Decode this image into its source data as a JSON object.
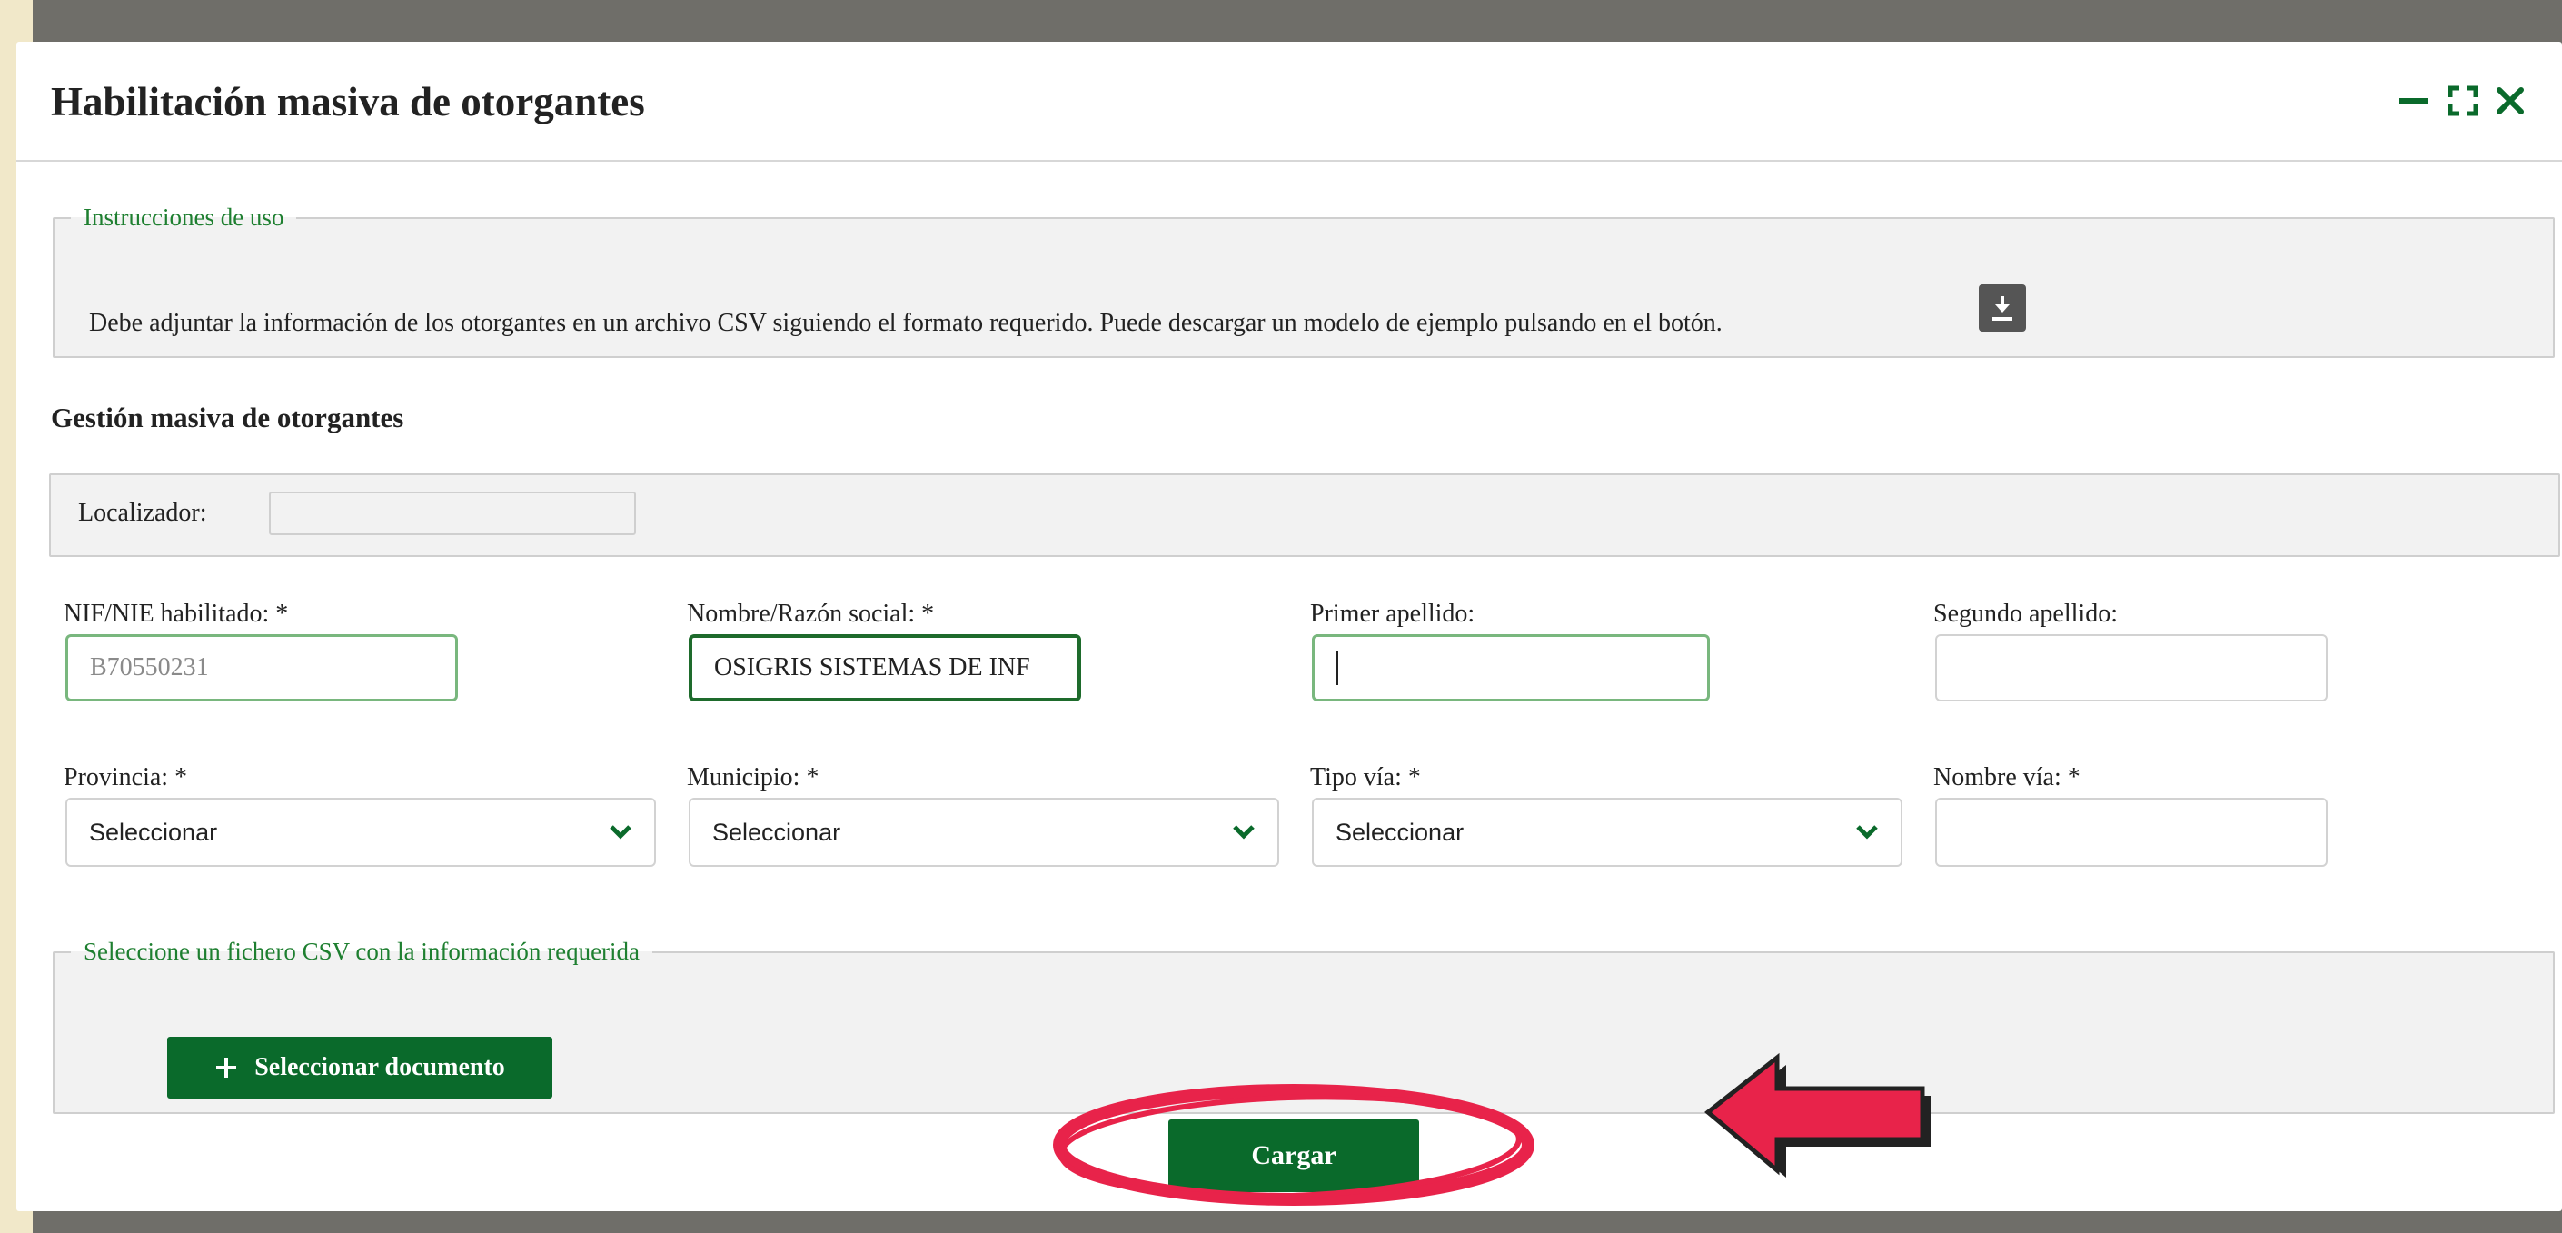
{
  "modal": {
    "title": "Habilitación masiva de otorgantes",
    "controls": [
      "minimize-icon",
      "maximize-icon",
      "close-icon"
    ]
  },
  "instructions": {
    "legend": "Instrucciones de uso",
    "text": "Debe adjuntar la información de los otorgantes en un archivo CSV siguiendo el formato requerido. Puede descargar un modelo de ejemplo pulsando en el botón.",
    "download_icon": "download-icon"
  },
  "section": {
    "title": "Gestión masiva de otorgantes"
  },
  "localizador": {
    "label": "Localizador:",
    "value": ""
  },
  "fields": {
    "nif": {
      "label": "NIF/NIE habilitado: *",
      "value": "B70550231"
    },
    "nombre": {
      "label": "Nombre/Razón social: *",
      "value": "OSIGRIS SISTEMAS DE INF"
    },
    "primer_apellido": {
      "label": "Primer apellido:",
      "value": ""
    },
    "segundo_apellido": {
      "label": "Segundo apellido:",
      "value": ""
    },
    "provincia": {
      "label": "Provincia: *",
      "value": "Seleccionar"
    },
    "municipio": {
      "label": "Municipio: *",
      "value": "Seleccionar"
    },
    "tipo_via": {
      "label": "Tipo vía: *",
      "value": "Seleccionar"
    },
    "nombre_via": {
      "label": "Nombre vía: *",
      "value": ""
    }
  },
  "file_section": {
    "legend": "Seleccione un fichero CSV con la información requerida",
    "button_label": "Seleccionar documento"
  },
  "actions": {
    "cargar_label": "Cargar"
  },
  "colors": {
    "brand_green": "#0A6A2B",
    "legend_green": "#1E7F30",
    "annotation_red": "#E8234A"
  }
}
